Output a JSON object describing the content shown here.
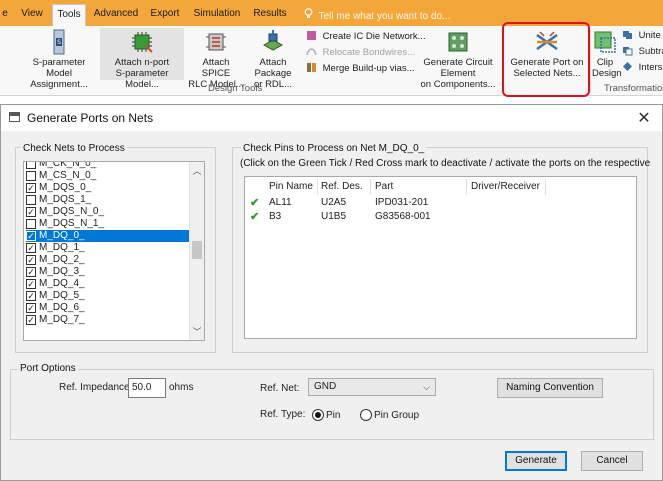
{
  "ribbon_tabs": {
    "partial_left": "e",
    "view": "View",
    "tools": "Tools",
    "advanced": "Advanced",
    "export": "Export",
    "simulation": "Simulation",
    "results": "Results",
    "tell_me": "Tell me what you want to do..."
  },
  "ribbon": {
    "sparam_model": [
      "S-parameter Model",
      "Assignment..."
    ],
    "attach_nport": [
      "Attach n-port",
      "S-parameter Model..."
    ],
    "attach_spice": [
      "Attach SPICE",
      "RLC Model..."
    ],
    "attach_package": [
      "Attach Package",
      "or RDL..."
    ],
    "create_ic_die": "Create IC Die Network...",
    "relocate_bondwires": "Relocate Bondwires...",
    "merge_buildup": "Merge Build-up vias...",
    "generate_circuit": [
      "Generate Circuit Element",
      "on Components..."
    ],
    "generate_port": [
      "Generate Port on",
      "Selected Nets..."
    ],
    "clip_design": [
      "Clip",
      "Design"
    ],
    "unite": "Unite",
    "subtract": "Subtra",
    "intersect": "Inters",
    "group_design_tools": "Design Tools",
    "group_transformations": "Transformation"
  },
  "dialog": {
    "title": "Generate Ports on Nets",
    "nets_label": "Check Nets to Process",
    "nets": [
      {
        "name": "M_CK_N_0_",
        "checked": false
      },
      {
        "name": "M_CS_N_0_",
        "checked": false
      },
      {
        "name": "M_DQS_0_",
        "checked": true
      },
      {
        "name": "M_DQS_1_",
        "checked": false
      },
      {
        "name": "M_DQS_N_0_",
        "checked": true
      },
      {
        "name": "M_DQS_N_1_",
        "checked": false
      },
      {
        "name": "M_DQ_0_",
        "checked": true,
        "selected": true
      },
      {
        "name": "M_DQ_1_",
        "checked": true
      },
      {
        "name": "M_DQ_2_",
        "checked": true
      },
      {
        "name": "M_DQ_3_",
        "checked": true
      },
      {
        "name": "M_DQ_4_",
        "checked": true
      },
      {
        "name": "M_DQ_5_",
        "checked": true
      },
      {
        "name": "M_DQ_6_",
        "checked": true
      },
      {
        "name": "M_DQ_7_",
        "checked": true
      }
    ],
    "pins_label": "Check Pins to Process on Net M_DQ_0_",
    "pins_hint": "(Click on the Green Tick / Red Cross mark to deactivate / activate the ports on the respective",
    "pin_columns": [
      "Pin Name",
      "Ref. Des.",
      "Part",
      "Driver/Receiver"
    ],
    "pins": [
      {
        "pin": "AL11",
        "ref": "U2A5",
        "part": "IPD031-201",
        "driver": ""
      },
      {
        "pin": "B3",
        "ref": "U1B5",
        "part": "G83568-001",
        "driver": ""
      }
    ],
    "port_options_label": "Port Options",
    "ref_impedance_label": "Ref. Impedance:",
    "ref_impedance_value": "50.0",
    "ohms": "ohms",
    "ref_net_label": "Ref. Net:",
    "ref_net_value": "GND",
    "naming_convention": "Naming Convention",
    "ref_type_label": "Ref. Type:",
    "ref_type_pin": "Pin",
    "ref_type_pin_group": "Pin Group",
    "ref_type_selected": "Pin",
    "generate": "Generate",
    "cancel": "Cancel"
  },
  "colors": {
    "ribbon_tab_bg": "#f3a73b",
    "highlight_red": "#e0111b",
    "selection_blue": "#0078d7",
    "tick_green": "#2f9a2f"
  }
}
